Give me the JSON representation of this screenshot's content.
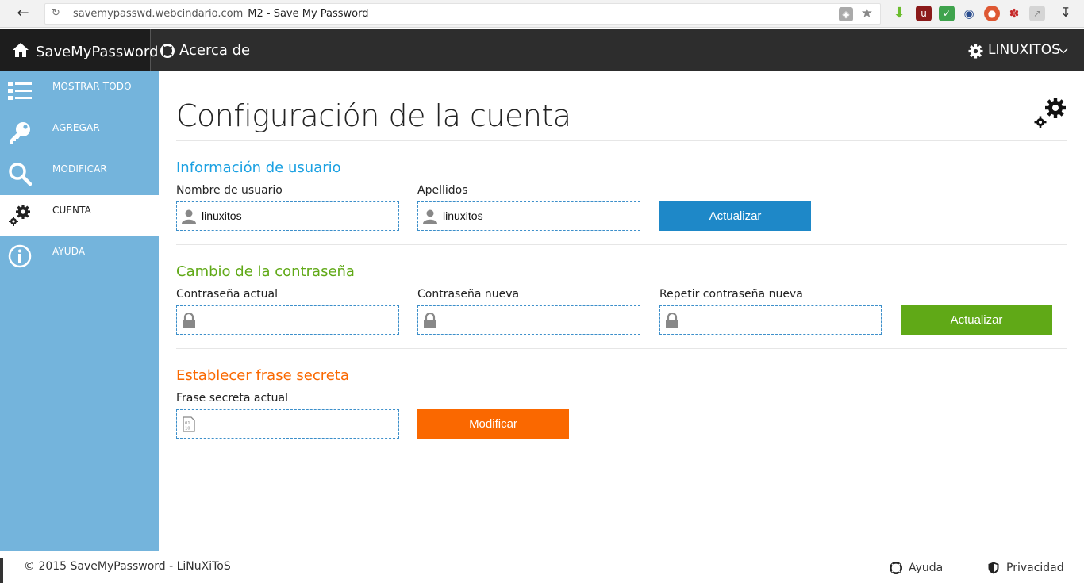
{
  "browser": {
    "url": "savemypasswd.webcindario.com",
    "page_title": "M2 - Save My Password"
  },
  "topbar": {
    "brand": "SaveMyPassword",
    "about": "Acerca de",
    "user": "LINUXITOS"
  },
  "sidebar": {
    "items": [
      {
        "label": "MOSTRAR TODO",
        "icon": "list-icon"
      },
      {
        "label": "AGREGAR",
        "icon": "key-icon"
      },
      {
        "label": "MODIFICAR",
        "icon": "search-icon"
      },
      {
        "label": "CUENTA",
        "icon": "gears-icon"
      },
      {
        "label": "AYUDA",
        "icon": "info-icon"
      }
    ]
  },
  "main": {
    "title": "Configuración de la cuenta",
    "user_info": {
      "title": "Información de usuario",
      "username_label": "Nombre de usuario",
      "username_value": "linuxitos",
      "lastname_label": "Apellidos",
      "lastname_value": "linuxitos",
      "button": "Actualizar"
    },
    "password_change": {
      "title": "Cambio de la contraseña",
      "current_label": "Contraseña actual",
      "new_label": "Contraseña nueva",
      "repeat_label": "Repetir contraseña nueva",
      "button": "Actualizar"
    },
    "secret_phrase": {
      "title": "Establecer frase secreta",
      "current_label": "Frase secreta actual",
      "button": "Modificar"
    }
  },
  "footer": {
    "copyright": "© 2015 SaveMyPassword - LiNuXiToS",
    "help": "Ayuda",
    "privacy": "Privacidad"
  },
  "colors": {
    "sidebar": "#74b4dc",
    "blue_accent": "#1e88c8",
    "green_accent": "#60a917",
    "orange_accent": "#fa6800"
  }
}
